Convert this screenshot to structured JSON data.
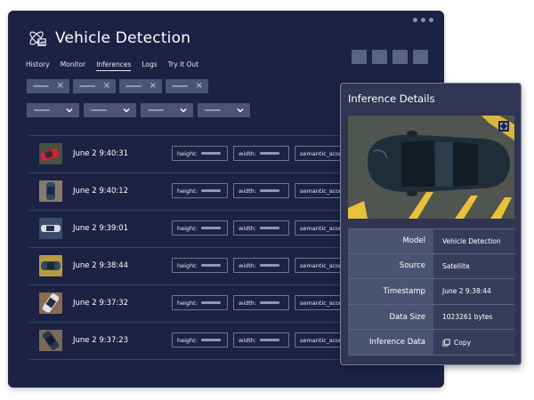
{
  "app": {
    "title": "Vehicle Detection"
  },
  "nav": {
    "tabs": [
      {
        "label": "History"
      },
      {
        "label": "Monitor"
      },
      {
        "label": "Inferences"
      },
      {
        "label": "Logs"
      },
      {
        "label": "Try it Out"
      }
    ],
    "active": "Inferences"
  },
  "filter_chips": [
    {
      "close": "×"
    },
    {
      "close": "×"
    },
    {
      "close": "×"
    },
    {
      "close": "×"
    }
  ],
  "inferences": {
    "field_labels": {
      "height": "height:",
      "width": "width:",
      "semantic": "semantic_score"
    },
    "rows": [
      {
        "timestamp": "June 2 9:40:31"
      },
      {
        "timestamp": "June 2 9:40:12"
      },
      {
        "timestamp": "June 2 9:39:01"
      },
      {
        "timestamp": "June 2 9:38:44"
      },
      {
        "timestamp": "June 2 9:37:32"
      },
      {
        "timestamp": "June 2 9:37:23"
      }
    ]
  },
  "details": {
    "title": "Inference Details",
    "rows": [
      {
        "key": "Model",
        "value": "Vehicle Detection"
      },
      {
        "key": "Source",
        "value": "Satellite"
      },
      {
        "key": "Timestamp",
        "value": "June 2 9:38:44"
      },
      {
        "key": "Data Size",
        "value": "1023261 bytes"
      }
    ],
    "inference_data": {
      "key": "Inference Data",
      "action": "Copy"
    }
  },
  "colors": {
    "window_bg": "#1b2244",
    "panel_bg": "#2f3553",
    "chip_bg": "#4c5476",
    "accent_yellow": "#e8c23a"
  },
  "icons": {
    "app_logo": "atom-chart-icon",
    "expand": "expand-icon",
    "copy": "copy-icon",
    "chevron": "chevron-down-icon",
    "close": "close-icon"
  }
}
